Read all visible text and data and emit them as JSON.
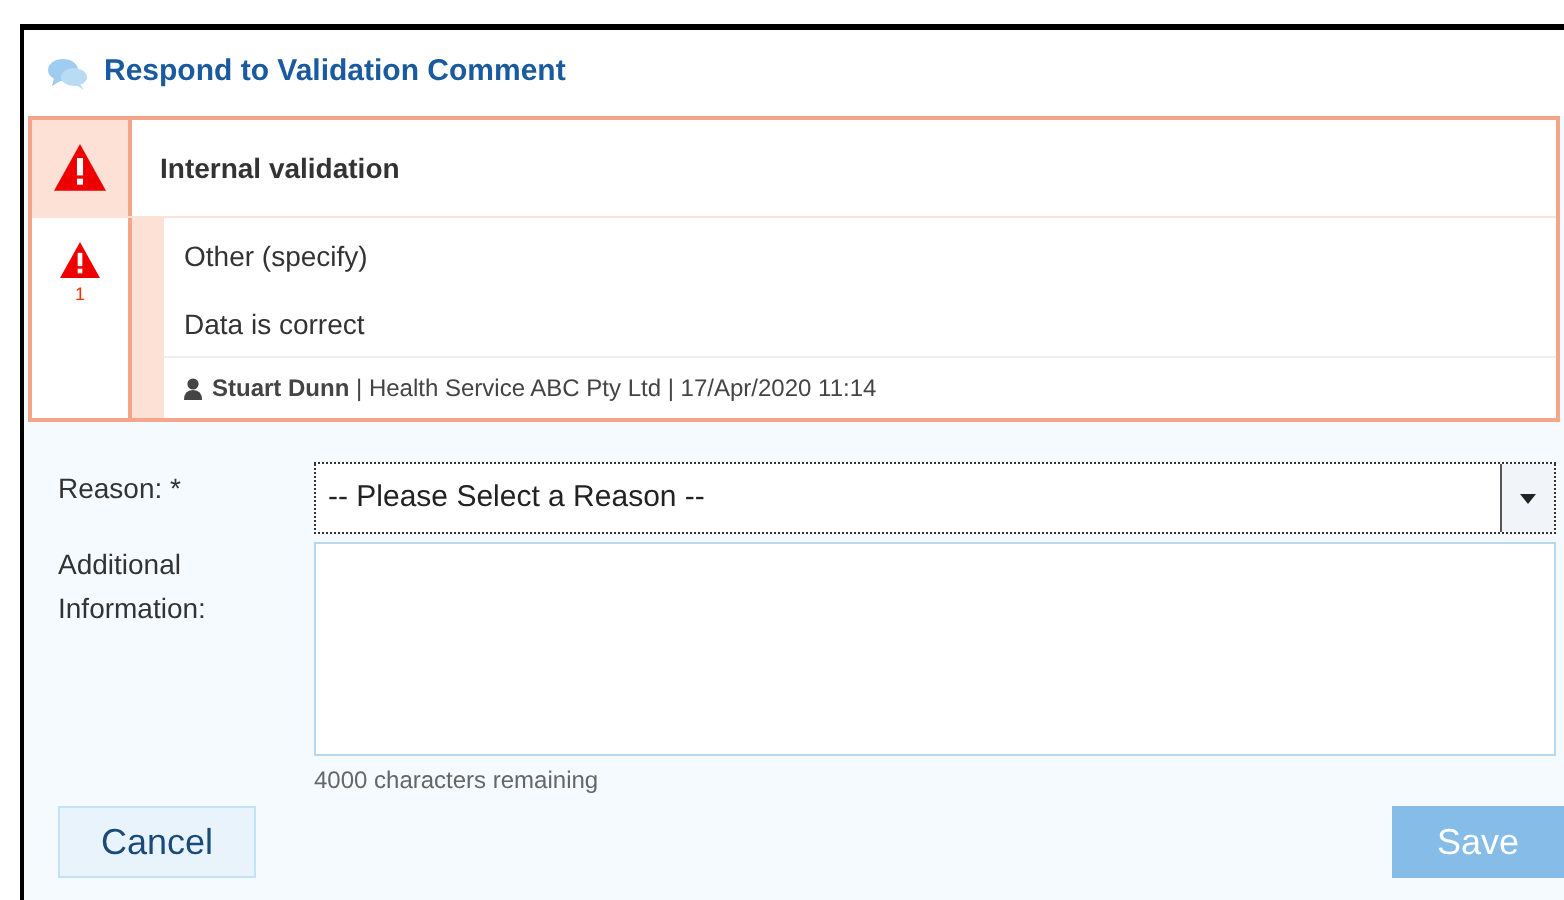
{
  "dialog": {
    "title": "Respond to Validation Comment"
  },
  "validation": {
    "title": "Internal validation",
    "count": "1",
    "comment": {
      "category": "Other (specify)",
      "text": "Data is correct",
      "author_line": "**Stuart Dunn** | Health Service ABC Pty Ltd | 17/Apr/2020 11:14"
    }
  },
  "form": {
    "reason_label": "Reason: *",
    "reason_placeholder": "-- Please Select a Reason --",
    "info_label": "Additional Information:",
    "remaining": "4000 characters remaining"
  },
  "buttons": [
    {
      "label": "Cancel",
      "kind": "secondary",
      "disabled": false
    },
    {
      "label": "Save",
      "kind": "primary",
      "disabled": true
    }
  ]
}
